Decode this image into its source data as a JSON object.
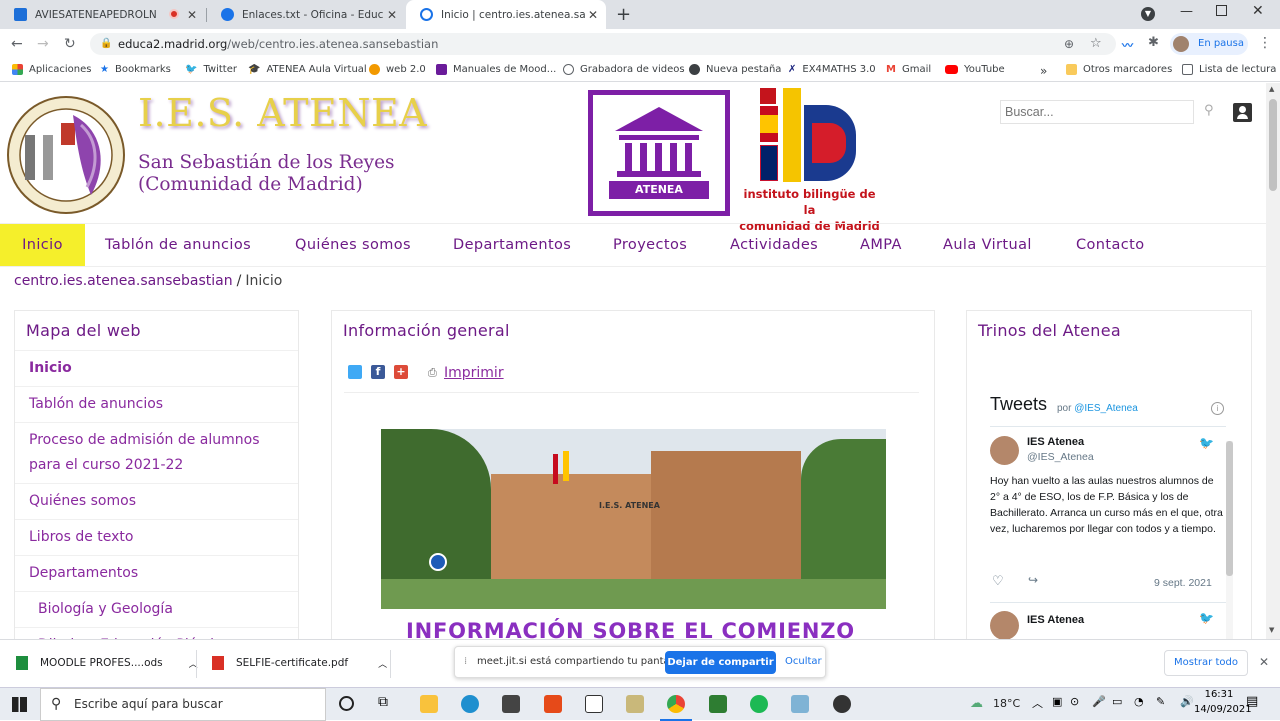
{
  "browser": {
    "tabs": [
      {
        "title": "AVIESATENEAPEDROLN | Jitsi Meet"
      },
      {
        "title": "Enlaces.txt - Oficina - EducaMadrid"
      },
      {
        "title": "Inicio | centro.ies.atenea.sansebastian"
      }
    ],
    "url_host": "educa2.madrid.org",
    "url_path": "/web/centro.ies.atenea.sansebastian",
    "profile_status": "En pausa",
    "bookmarks": [
      "Aplicaciones",
      "Bookmarks",
      "Twitter",
      "ATENEA Aula Virtual",
      "web 2.0",
      "Manuales de Mood...",
      "Grabadora de videos",
      "Nueva pestaña",
      "EX4MATHS 3.0",
      "Gmail",
      "YouTube"
    ],
    "other_bookmarks": "Otros marcadores",
    "reading_list": "Lista de lectura",
    "more": "»"
  },
  "site": {
    "title": "I.E.S. ATENEA",
    "subtitle_line1": "San Sebastián de los Reyes",
    "subtitle_line2": "(Comunidad de Madrid)",
    "logo_text": "ATENEA",
    "bilingual_line1": "instituto bilingüe de la",
    "bilingual_line2": "comunidad de Madrid",
    "search_placeholder": "Buscar...",
    "nav": [
      "Inicio",
      "Tablón de anuncios",
      "Quiénes somos",
      "Departamentos",
      "Proyectos",
      "Actividades",
      "AMPA",
      "Aula Virtual",
      "Contacto"
    ],
    "breadcrumb_root": "centro.ies.atenea.sansebastian",
    "breadcrumb_sep": "/",
    "breadcrumb_current": "Inicio",
    "sitemap_title": "Mapa del web",
    "sitemap": [
      "Inicio",
      "Tablón de anuncios",
      "Proceso de admisión de alumnos para el curso 2021-22",
      "Quiénes somos",
      "Libros de texto",
      "Departamentos",
      "Biología y Geología",
      "Dibujo y Educación Plástica y Visual"
    ],
    "info_title": "Información general",
    "print_label": "Imprimir",
    "photo_sign": "I.E.S. ATENEA",
    "main_heading": "INFORMACIÓN SOBRE EL COMIENZO",
    "trinos_title": "Trinos del Atenea"
  },
  "twitter": {
    "title": "Tweets",
    "by": "por",
    "handle_link": "@IES_Atenea",
    "author": "IES Atenea",
    "author_handle": "@IES_Atenea",
    "text": "Hoy han vuelto a las aulas nuestros alumnos de 2° a 4° de ESO, los de F.P. Básica y los de Bachillerato. Arranca un curso más en el que, otra vez, lucharemos por llegar con todos y a tiempo.",
    "date": "9 sept. 2021",
    "author2": "IES Atenea"
  },
  "downloads": {
    "file1": "MOODLE PROFES....ods",
    "file2": "SELFIE-certificate.pdf",
    "show_all": "Mostrar todo"
  },
  "share_bar": {
    "message": "meet.jit.si está compartiendo tu pantalla.",
    "stop": "Dejar de compartir",
    "hide": "Ocultar"
  },
  "taskbar": {
    "search_placeholder": "Escribe aquí para buscar",
    "temperature": "18°C",
    "time": "16:31",
    "date": "14/09/2021"
  }
}
